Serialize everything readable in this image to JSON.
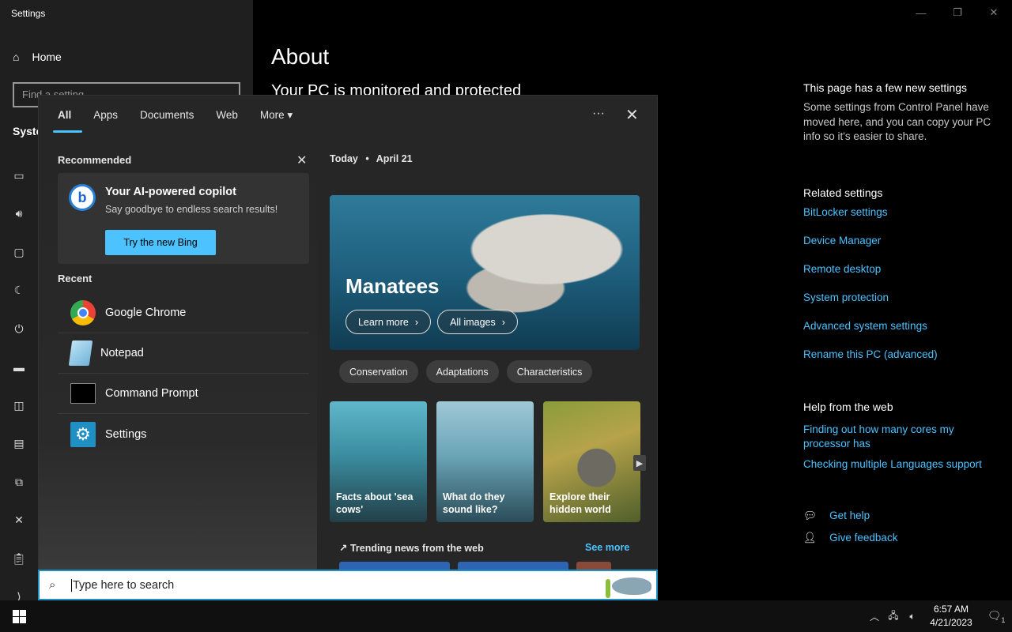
{
  "window": {
    "title": "Settings"
  },
  "sidebar": {
    "home_label": "Home",
    "search_placeholder": "Find a setting",
    "section_label": "Syste"
  },
  "main": {
    "title": "About",
    "subtitle": "Your PC is monitored and protected"
  },
  "right_panel": {
    "new_settings_heading": "This page has a few new settings",
    "new_settings_text": "Some settings from Control Panel have moved here, and you can copy your PC info so it's easier to share.",
    "related_heading": "Related settings",
    "related_links": [
      "BitLocker settings",
      "Device Manager",
      "Remote desktop",
      "System protection",
      "Advanced system settings",
      "Rename this PC (advanced)"
    ],
    "help_heading": "Help from the web",
    "help_links": [
      "Finding out how many cores my processor has",
      "Checking multiple Languages support"
    ],
    "get_help": "Get help",
    "give_feedback": "Give feedback"
  },
  "search_flyout": {
    "tabs": [
      "All",
      "Apps",
      "Documents",
      "Web",
      "More"
    ],
    "recommended_label": "Recommended",
    "copilot_title": "Your AI-powered copilot",
    "copilot_sub": "Say goodbye to endless search results!",
    "bing_button": "Try the new Bing",
    "recent_label": "Recent",
    "recent_items": [
      "Google Chrome",
      "Notepad",
      "Command Prompt",
      "Settings"
    ],
    "today_label": "Today",
    "today_date": "April 21",
    "hero_title": "Manatees",
    "learn_more": "Learn more",
    "all_images": "All images",
    "chips": [
      "Conservation",
      "Adaptations",
      "Characteristics"
    ],
    "cards": [
      "Facts about 'sea cows'",
      "What do they sound like?",
      "Explore their hidden world"
    ],
    "trending_label": "Trending news from the web",
    "see_more": "See more"
  },
  "searchbar": {
    "placeholder": "Type here to search"
  },
  "taskbar": {
    "time": "6:57 AM",
    "date": "4/21/2023",
    "notification_count": "1"
  },
  "colors": {
    "accent": "#4cc2ff",
    "search_border": "#1f8fc4"
  }
}
